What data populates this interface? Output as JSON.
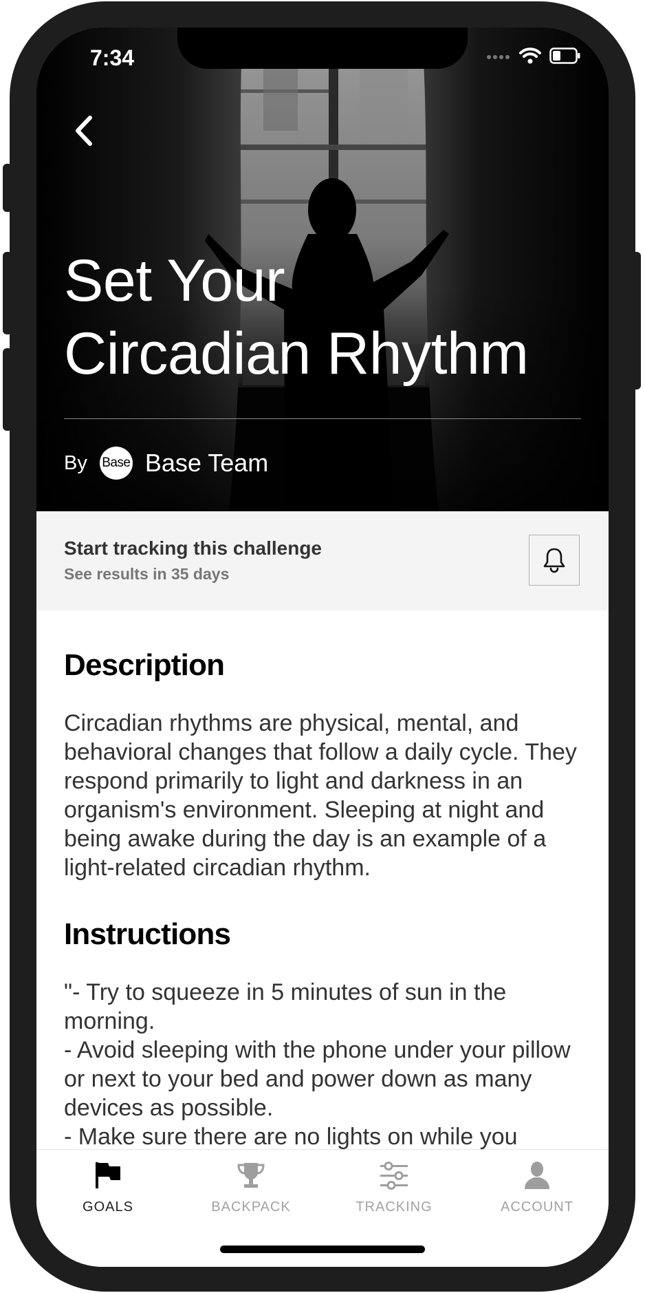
{
  "status_bar": {
    "time": "7:34"
  },
  "hero": {
    "title_line1": "Set Your",
    "title_line2": "Circadian Rhythm",
    "author_prefix": "By",
    "author_avatar_text": "Base",
    "author_name": "Base Team"
  },
  "tracking": {
    "title": "Start tracking this challenge",
    "subtitle": "See results in 35 days"
  },
  "description": {
    "heading": "Description",
    "body": "Circadian rhythms are physical, mental, and behavioral changes that follow a daily cycle. They respond primarily to light and darkness in an organism's environment. Sleeping at night and being awake during the day is an example of a light-related circadian rhythm."
  },
  "instructions": {
    "heading": "Instructions",
    "body": "\"- Try to squeeze in 5 minutes of sun in the morning.\n- Avoid sleeping with the phone under your pillow or next to your bed and power down as many devices as possible.\n- Make sure there are no lights on while you"
  },
  "bottom_nav": {
    "items": [
      {
        "label": "GOALS",
        "icon": "flag-icon",
        "active": true
      },
      {
        "label": "BACKPACK",
        "icon": "trophy-icon",
        "active": false
      },
      {
        "label": "TRACKING",
        "icon": "sliders-icon",
        "active": false
      },
      {
        "label": "ACCOUNT",
        "icon": "person-icon",
        "active": false
      }
    ]
  },
  "colors": {
    "frame": "#1e1e1e",
    "tracking_bg": "#f4f4f4",
    "nav_active": "#222222",
    "nav_inactive": "#a3a3a3"
  }
}
